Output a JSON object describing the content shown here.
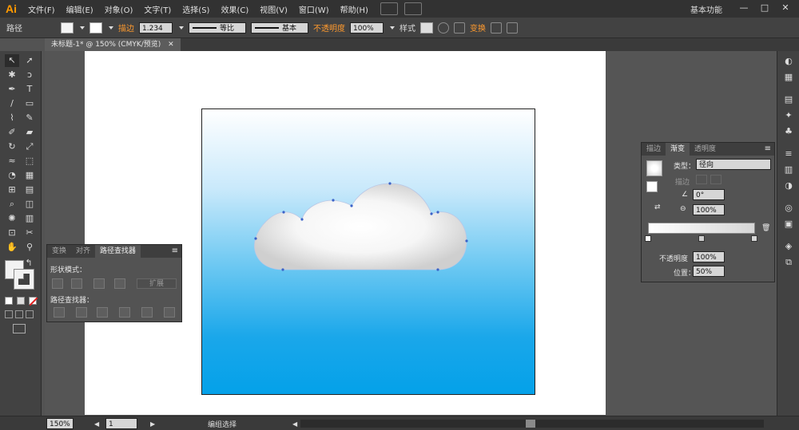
{
  "app": {
    "logo": "Ai",
    "menu": [
      "文件(F)",
      "编辑(E)",
      "对象(O)",
      "文字(T)",
      "选择(S)",
      "效果(C)",
      "视图(V)",
      "窗口(W)",
      "帮助(H)"
    ],
    "workspace": "基本功能",
    "window_buttons": [
      "—",
      "□",
      "✕"
    ]
  },
  "control_bar": {
    "selection_label": "路径",
    "stroke_label": "描边",
    "stroke_weight": "1.234",
    "stroke_profile_label": "等比",
    "brush_label": "基本",
    "opacity_label": "不透明度",
    "opacity_value": "100%",
    "style_label": "样式",
    "transform_label": "变换"
  },
  "document": {
    "tab_title": "未标题-1* @ 150% (CMYK/预览)"
  },
  "pathfinder_panel": {
    "tabs": [
      "变换",
      "对齐",
      "路径查找器"
    ],
    "shape_modes_label": "形状模式：",
    "expand_button": "扩展",
    "pathfinders_label": "路径查找器："
  },
  "gradient_panel": {
    "tabs": [
      "描边",
      "渐变",
      "透明度"
    ],
    "type_label": "类型：",
    "type_value": "径向",
    "stroke_label": "描边",
    "angle_value": "0°",
    "aspect_value": "100%",
    "opacity_label": "不透明度",
    "opacity_value": "100%",
    "location_label": "位置：",
    "location_value": "50%"
  },
  "status_bar": {
    "zoom": "150%",
    "page": "1",
    "tool_status": "编组选择"
  },
  "colors": {
    "accent": "#ff9a2e",
    "sky_top": "#ffffff",
    "sky_bottom": "#04a1e9",
    "cloud_edge": "#d2d2d2",
    "anchor": "#3a62c8"
  }
}
